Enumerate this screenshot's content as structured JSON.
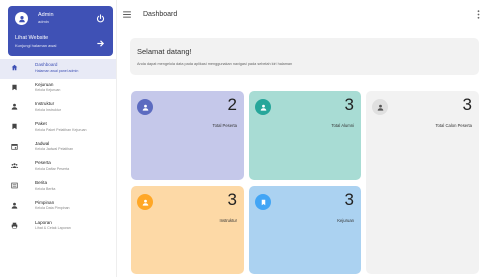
{
  "sidebar": {
    "profile": {
      "name": "Admin",
      "role": "admin"
    },
    "visit": {
      "title": "Lihat Website",
      "subtitle": "Kunjungi halaman awal"
    },
    "items": [
      {
        "title": "Dashboard",
        "subtitle": "Halaman awal panel admin",
        "icon": "home-icon",
        "active": true
      },
      {
        "title": "Kejuruan",
        "subtitle": "Kelola Kejuruan",
        "icon": "bookmark-icon"
      },
      {
        "title": "Instruktur",
        "subtitle": "Kelola Instruktur",
        "icon": "user-icon"
      },
      {
        "title": "Paket",
        "subtitle": "Kelola Paket Pelatihan Kejuruan",
        "icon": "bookmark-icon"
      },
      {
        "title": "Jadwal",
        "subtitle": "Kelola Jadwal Pelatihan",
        "icon": "calendar-icon"
      },
      {
        "title": "Peserta",
        "subtitle": "Kelola Daftar Peserta",
        "icon": "group-icon"
      },
      {
        "title": "Berita",
        "subtitle": "Kelola Berita",
        "icon": "news-icon"
      },
      {
        "title": "Pimpinan",
        "subtitle": "Kelola Data Pimpinan",
        "icon": "user-icon"
      },
      {
        "title": "Laporan",
        "subtitle": "Lihat & Cetak Laporan",
        "icon": "printer-icon"
      }
    ]
  },
  "header": {
    "title": "Dashboard"
  },
  "welcome": {
    "title": "Selamat datang!",
    "text": "Anda dapat mengelola data pada aplikasi menggunakan navigasi pada sebelah kiri halaman"
  },
  "cards": [
    {
      "value": "2",
      "label": "Total Peserta",
      "bg": "#c5c8ea",
      "icon_bg": "#5c6bc0",
      "icon": "user-icon"
    },
    {
      "value": "3",
      "label": "Total Alumni",
      "bg": "#a8dcd4",
      "icon_bg": "#26a69a",
      "icon": "user-icon"
    },
    {
      "value": "3",
      "label": "Total Calon Peserta",
      "bg": "#f2f2f2",
      "icon_bg": "#e0e0e0",
      "icon": "user-icon"
    },
    {
      "value": "3",
      "label": "Instruktur",
      "bg": "#fdd9a6",
      "icon_bg": "#ffa726",
      "icon": "user-icon"
    },
    {
      "value": "3",
      "label": "Kejuruan",
      "bg": "#abd2f1",
      "icon_bg": "#42a5f5",
      "icon": "bookmark-icon"
    }
  ],
  "colors": {
    "primary": "#3f51b5"
  }
}
